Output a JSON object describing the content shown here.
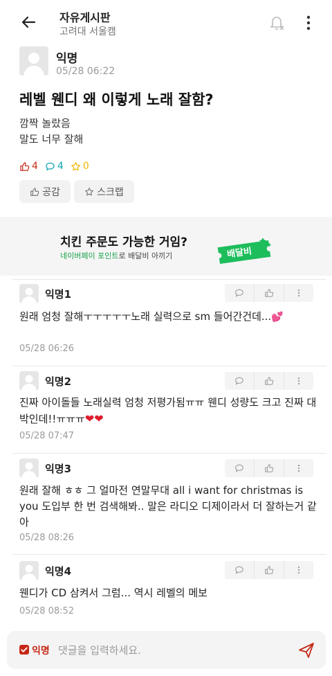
{
  "header": {
    "board_title": "자유게시판",
    "board_subtitle": "고려대 서울캠"
  },
  "post": {
    "author": "익명",
    "time": "05/28 06:22",
    "title": "레벨 웬디 왜 이렇게 노래 잘함?",
    "body_lines": [
      "깜짝 놀랐음",
      "말도 너무 잘해"
    ],
    "likes": "4",
    "comments": "4",
    "scraps": "0",
    "like_button_label": "공감",
    "scrap_button_label": "스크랩"
  },
  "banner": {
    "title": "치킨 주문도 가능한 거임?",
    "sub_highlight": "네이버페이 포인트",
    "sub_rest": "로 배달비 아끼기",
    "ticket_label": "배달비"
  },
  "comments": [
    {
      "author": "익명1",
      "text": "원래 엄청 잘해ㅜㅜㅜㅜㅜ노래 실력으로 sm 들어간건데...",
      "emoji": "💕",
      "time": "05/28 06:26"
    },
    {
      "author": "익명2",
      "text": "진짜 아이돌들 노래실력 엄청 저평가됨ㅠㅠ 웬디 성량도 크고 진짜 대박인데!!ㅠㅠㅠ",
      "emoji": "❤❤",
      "time": "05/28 07:47"
    },
    {
      "author": "익명3",
      "text": "원래 잘해 ㅎㅎ 그 얼마전 연말무대 all i want for christmas is you 도입부 한 번 검색해봐.. 말은 라디오 디제이라서 더 잘하는거 같아",
      "emoji": "",
      "time": "05/28 08:26"
    },
    {
      "author": "익명4",
      "text": "웬디가 CD 삼켜서 그럼... 역시 레벨의 메보",
      "emoji": "",
      "time": "05/28 08:52"
    }
  ],
  "input": {
    "anon_label": "익명",
    "placeholder": "댓글을 입력하세요."
  },
  "colors": {
    "accent_red": "#c62917",
    "comment_teal": "#0ca5b0",
    "scrap_yellow": "#f2b600",
    "naverpay_green": "#17a34a",
    "ticket_green": "#1dbd5c"
  },
  "icons": [
    "back-arrow-icon",
    "bell-off-icon",
    "more-vertical-icon",
    "thumbs-up-icon",
    "speech-bubble-icon",
    "star-icon",
    "send-icon",
    "checkbox-icon"
  ]
}
